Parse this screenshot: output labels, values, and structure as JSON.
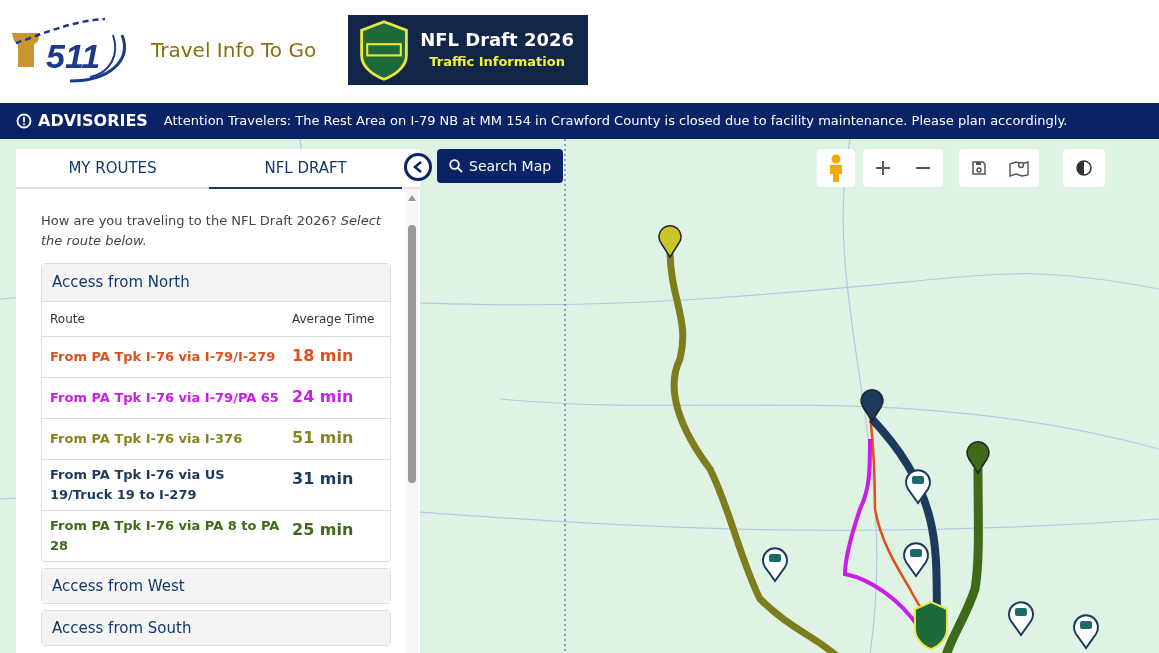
{
  "header": {
    "logo_text": "511",
    "tagline": "Travel Info To Go",
    "banner": {
      "title": "NFL Draft 2026",
      "subtitle": "Traffic Information"
    }
  },
  "advisory": {
    "label": "ADVISORIES",
    "message": "Attention Travelers: The Rest Area on I-79 NB at MM 154 in Crawford County is closed due to facility maintenance. Please plan accordingly."
  },
  "panel": {
    "tabs": [
      {
        "label": "MY ROUTES",
        "selected": false
      },
      {
        "label": "NFL DRAFT",
        "selected": true
      }
    ],
    "intro": "How are you traveling to the NFL Draft 2026? *Select the route below.*",
    "sections": [
      {
        "title": "Access from North",
        "expanded": true,
        "columns": [
          "Route",
          "Average Time"
        ],
        "rows": [
          {
            "route": "From PA Tpk I-76 via I-79/I-279",
            "time": "18 min",
            "color": "#e0501a"
          },
          {
            "route": "From PA Tpk I-76 via I-79/PA 65",
            "time": "24 min",
            "color": "#c81ee8"
          },
          {
            "route": "From PA Tpk I-76 via I-376",
            "time": "51 min",
            "color": "#85851f"
          },
          {
            "route": "From PA Tpk I-76 via US 19/Truck 19 to I-279",
            "time": "31 min",
            "color": "#1c3a5e"
          },
          {
            "route": "From PA Tpk I-76 via PA 8 to PA 28",
            "time": "25 min",
            "color": "#3d6b1a"
          }
        ]
      },
      {
        "title": "Access from West",
        "expanded": false
      },
      {
        "title": "Access from South",
        "expanded": false
      }
    ]
  },
  "map": {
    "search_button": "Search Map"
  }
}
